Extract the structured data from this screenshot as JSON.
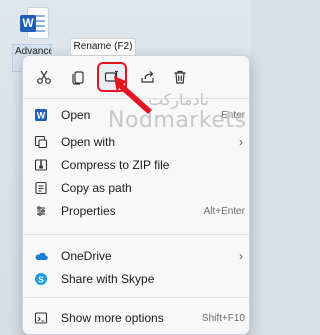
{
  "desktop": {
    "file_icon_letter": "W",
    "file_label": "Advance Pa"
  },
  "tooltip": {
    "text": "Rename (F2)"
  },
  "toolbar": {
    "buttons": [
      {
        "name": "cut",
        "icon": "scissors-icon"
      },
      {
        "name": "copy",
        "icon": "copy-icon"
      },
      {
        "name": "rename",
        "icon": "rename-icon"
      },
      {
        "name": "share",
        "icon": "share-icon"
      },
      {
        "name": "delete",
        "icon": "trash-icon"
      }
    ]
  },
  "menu": {
    "items": [
      {
        "label": "Open",
        "shortcut": "Enter",
        "icon": "word-icon"
      },
      {
        "label": "Open with",
        "shortcut": "",
        "icon": "open-with-icon",
        "submenu": true
      },
      {
        "label": "Compress to ZIP file",
        "shortcut": "",
        "icon": "zip-icon"
      },
      {
        "label": "Copy as path",
        "shortcut": "",
        "icon": "copy-path-icon"
      },
      {
        "label": "Properties",
        "shortcut": "Alt+Enter",
        "icon": "properties-icon"
      },
      {
        "label": "OneDrive",
        "shortcut": "",
        "icon": "onedrive-icon",
        "submenu": true
      },
      {
        "label": "Share with Skype",
        "shortcut": "",
        "icon": "skype-icon"
      },
      {
        "label": "Show more options",
        "shortcut": "Shift+F10",
        "icon": "more-options-icon"
      }
    ]
  },
  "watermark": {
    "fa": "نادمارکت",
    "en": "Nodmarkets"
  },
  "colors": {
    "highlight": "#e4151f",
    "accent": "#1f5fb8"
  }
}
